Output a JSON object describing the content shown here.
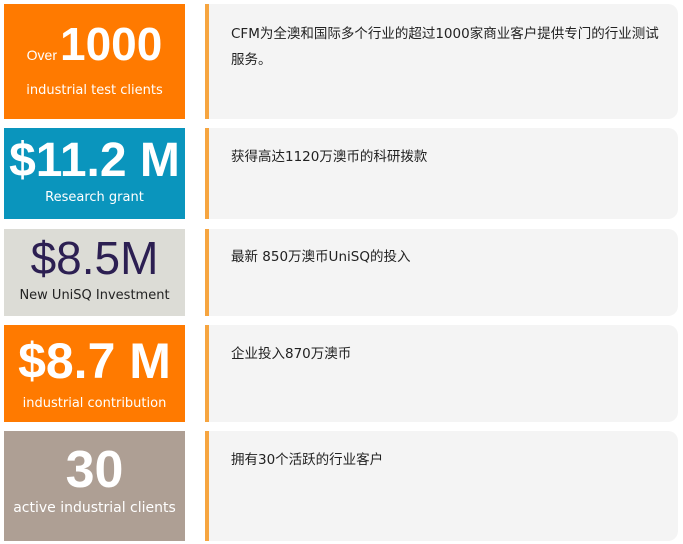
{
  "stats": [
    {
      "prefix": "Over",
      "value": "1000",
      "caption": "industrial test clients",
      "color": "#ff7a00",
      "text_color": "#ffffff",
      "description": "CFM为全澳和国际多个行业的超过1000家商业客户提供专门的行业测试服务。"
    },
    {
      "prefix": "",
      "value": "$11.2 M",
      "caption": "Research grant",
      "color": "#0a95bd",
      "text_color": "#ffffff",
      "description": "获得高达1120万澳币的科研拨款"
    },
    {
      "prefix": "",
      "value": "$8.5M",
      "caption": "New UniSQ Investment",
      "color": "#dcdcd6",
      "text_color": "#2c1f52",
      "description": "最新 850万澳币UniSQ的投入"
    },
    {
      "prefix": "",
      "value": "$8.7 M",
      "caption": "industrial contribution",
      "color": "#ff7a00",
      "text_color": "#ffffff",
      "description": "企业投入870万澳币"
    },
    {
      "prefix": "",
      "value": "30",
      "caption": "active industrial clients",
      "color": "#ae9f94",
      "text_color": "#ffffff",
      "description": "拥有30个活跃的行业客户"
    }
  ],
  "accent_color": "#f6a540"
}
